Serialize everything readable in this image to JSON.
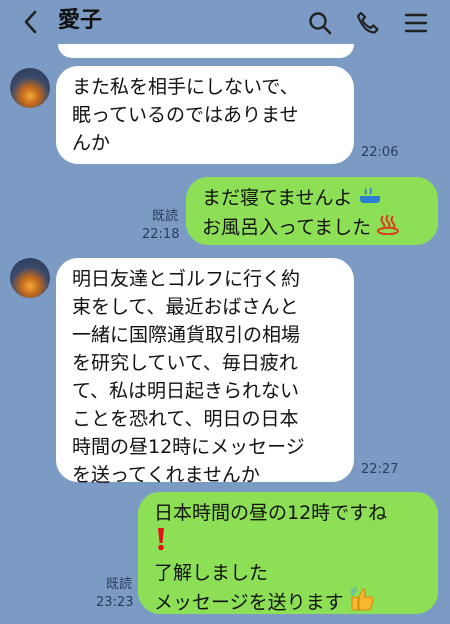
{
  "header": {
    "title": "愛子",
    "back_icon": "chevron-left-icon",
    "search_icon": "search-icon",
    "call_icon": "phone-icon",
    "menu_icon": "menu-icon"
  },
  "messages": [
    {
      "side": "left",
      "lines": [
        "また私を相手にしないで、",
        "眠っているのではありませ",
        "んか"
      ],
      "time": "22:06"
    },
    {
      "side": "right",
      "lines": [
        "まだ寝てませんよ",
        "お風呂入ってました"
      ],
      "emoji": [
        "bath-icon",
        "hot-springs-icon"
      ],
      "read": "既読",
      "time": "22:18"
    },
    {
      "side": "left",
      "lines": [
        "明日友達とゴルフに行く約",
        "束をして、最近おばさんと",
        "一緒に国際通貨取引の相場",
        "を研究していて、毎日疲れ",
        "て、私は明日起きられない",
        "ことを恐れて、明日の日本",
        "時間の昼12時にメッセージ",
        "を送ってくれませんか"
      ],
      "time": "22:27"
    },
    {
      "side": "right",
      "lines": [
        "日本時間の昼の12時ですね",
        "",
        "了解しました",
        "メッセージを送ります"
      ],
      "emoji": [
        "exclamation-icon",
        "thumbs-up-icon"
      ],
      "read": "既読",
      "time": "23:23"
    }
  ],
  "colors": {
    "background": "#7b9bc4",
    "incoming_bubble": "#ffffff",
    "outgoing_bubble": "#8de055"
  }
}
